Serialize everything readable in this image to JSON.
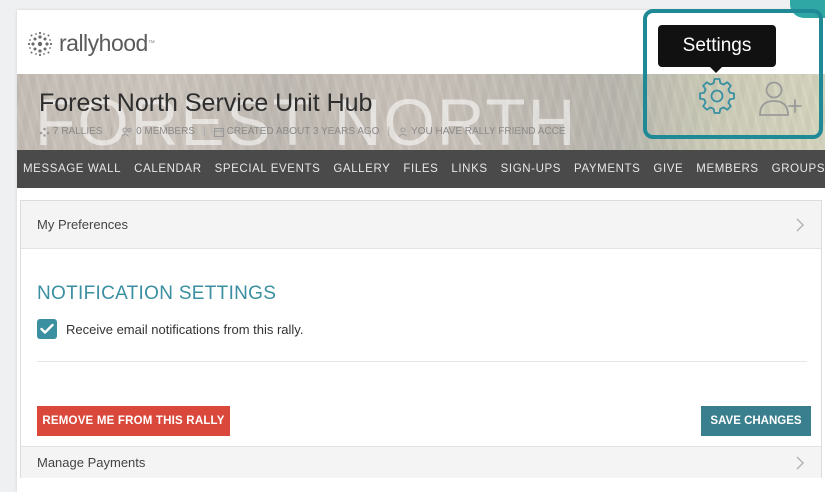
{
  "brand": {
    "name": "rallyhood",
    "trademark": "™"
  },
  "hub": {
    "title": "Forest North Service Unit Hub",
    "ghost_text": "FOREST NORTH",
    "meta": {
      "rallies": "7 RALLIES",
      "members": "0 MEMBERS",
      "created": "CREATED ABOUT 3 YEARS AGO",
      "access": "YOU HAVE RALLY FRIEND ACCE"
    }
  },
  "tooltip": {
    "text": "Settings"
  },
  "icons": {
    "settings": "gear-icon",
    "add_member": "add-user-icon"
  },
  "nav": {
    "items": [
      {
        "label": "MESSAGE WALL"
      },
      {
        "label": "CALENDAR"
      },
      {
        "label": "SPECIAL EVENTS"
      },
      {
        "label": "GALLERY"
      },
      {
        "label": "FILES"
      },
      {
        "label": "LINKS"
      },
      {
        "label": "SIGN-UPS"
      },
      {
        "label": "PAYMENTS"
      },
      {
        "label": "GIVE"
      },
      {
        "label": "MEMBERS"
      },
      {
        "label": "GROUPS"
      }
    ]
  },
  "preferences": {
    "label": "My Preferences"
  },
  "notifications": {
    "title": "NOTIFICATION SETTINGS",
    "email_label": "Receive email notifications from this rally.",
    "email_checked": true
  },
  "actions": {
    "remove_label": "REMOVE ME FROM THIS RALLY",
    "save_label": "SAVE CHANGES"
  },
  "payments": {
    "label": "Manage Payments"
  },
  "colors": {
    "accent": "#3a8fa0",
    "danger": "#d9483b",
    "save": "#3a7f8e",
    "nav_bg": "#4a4a4a",
    "highlight": "#1f8a96"
  }
}
